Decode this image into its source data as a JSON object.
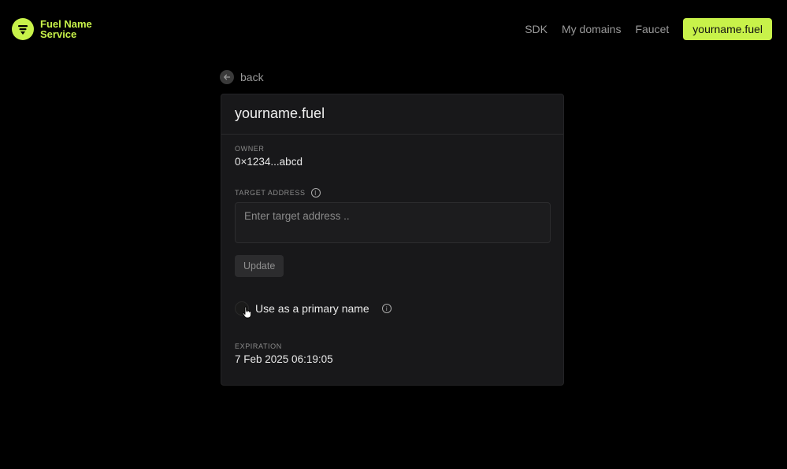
{
  "header": {
    "logo_text": "Fuel Name Service",
    "nav": {
      "sdk": "SDK",
      "my_domains": "My domains",
      "faucet": "Faucet",
      "domain_button": "yourname.fuel"
    }
  },
  "back_label": "back",
  "card": {
    "title": "yourname.fuel",
    "owner": {
      "label": "OWNER",
      "value": "0×1234...abcd"
    },
    "target_address": {
      "label": "TARGET ADDRESS",
      "placeholder": "Enter target address ..",
      "value": ""
    },
    "update_label": "Update",
    "primary_name": {
      "label": "Use as a primary name",
      "checked": false
    },
    "expiration": {
      "label": "EXPIRATION",
      "value": "7 Feb 2025 06:19:05"
    }
  },
  "colors": {
    "accent": "#c8f24a",
    "background": "#000000",
    "card": "#18181a"
  },
  "icons": {
    "logo": "fuel-logo-icon",
    "back": "arrow-left-icon",
    "info": "info-icon",
    "cursor": "pointer-cursor-icon"
  }
}
